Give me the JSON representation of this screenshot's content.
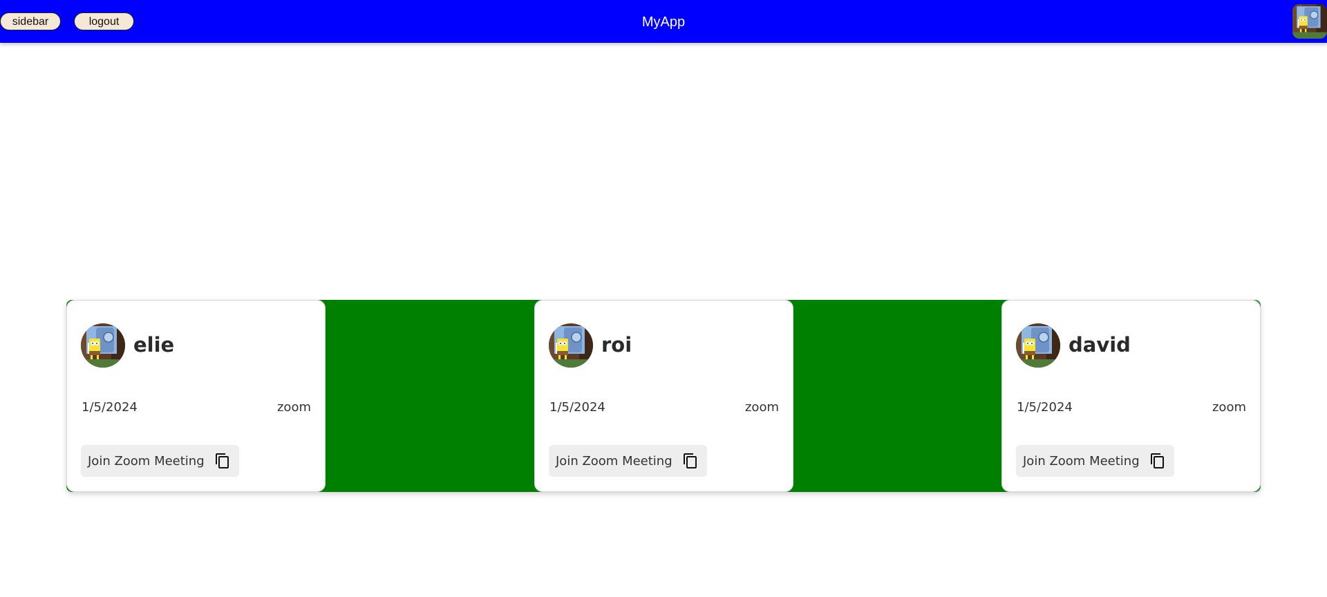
{
  "header": {
    "sidebar_label": "sidebar",
    "logout_label": "logout",
    "title": "MyApp",
    "avatar_icon": "spongebob-avatar-icon"
  },
  "colors": {
    "header_bg": "#0000ff",
    "strip_bg": "#008000",
    "button_bg": "#f6e8d6",
    "card_bg": "#ffffff"
  },
  "meetings": [
    {
      "name": "elie",
      "date": "1/5/2024",
      "platform": "zoom",
      "join_label": "Join Zoom Meeting",
      "copy_icon": "copy-icon"
    },
    {
      "name": "roi",
      "date": "1/5/2024",
      "platform": "zoom",
      "join_label": "Join Zoom Meeting",
      "copy_icon": "copy-icon"
    },
    {
      "name": "david",
      "date": "1/5/2024",
      "platform": "zoom",
      "join_label": "Join Zoom Meeting",
      "copy_icon": "copy-icon"
    }
  ]
}
